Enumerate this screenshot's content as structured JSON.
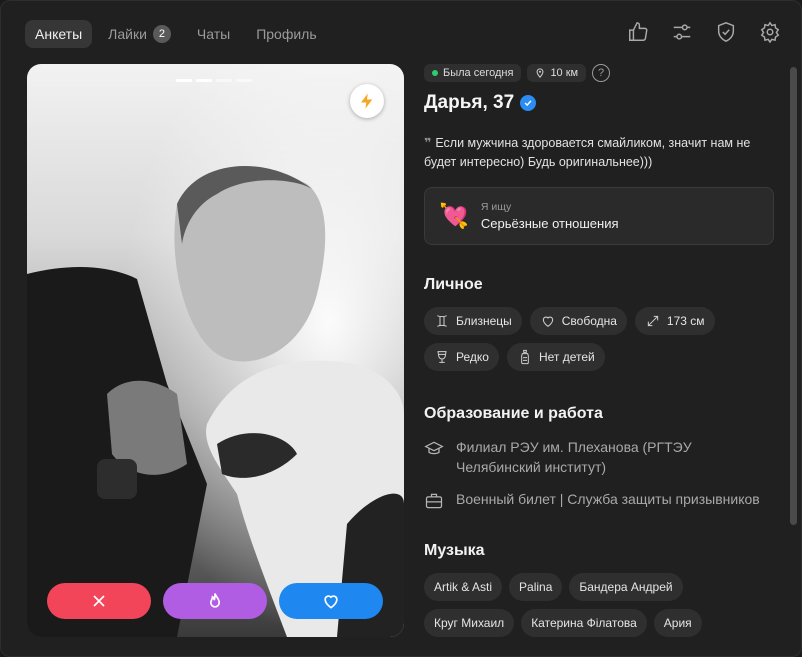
{
  "tabs": [
    {
      "label": "Анкеты",
      "active": true
    },
    {
      "label": "Лайки",
      "badge": "2"
    },
    {
      "label": "Чаты"
    },
    {
      "label": "Профиль"
    }
  ],
  "top_icons": [
    "thumbs-up-icon",
    "sliders-icon",
    "shield-check-icon",
    "gear-icon"
  ],
  "photo": {
    "pages_total": 4,
    "pages_active": 2
  },
  "status": {
    "online": "Была сегодня",
    "distance": "10 км",
    "help": "?"
  },
  "profile": {
    "name": "Дарья, 37"
  },
  "bio": "Если мужчина здоровается смайликом, значит нам не будет интересно) Будь оригинальнее)))",
  "seeking": {
    "label": "Я ищу",
    "value": "Серьёзные отношения"
  },
  "personal": {
    "title": "Личное",
    "chips": [
      {
        "label": "Близнецы",
        "icon": "gemini-icon"
      },
      {
        "label": "Свободна",
        "icon": "heart-outline-icon"
      },
      {
        "label": "173 см",
        "icon": "height-arrows-icon"
      },
      {
        "label": "Редко",
        "icon": "wine-glass-icon"
      },
      {
        "label": "Нет детей",
        "icon": "baby-bottle-icon"
      }
    ]
  },
  "education": {
    "title": "Образование и работа",
    "items": [
      {
        "text": "Филиал РЭУ им. Плеханова (РГТЭУ Челябинский институт)",
        "icon": "graduation-cap-icon"
      },
      {
        "text": "Военный билет | Служба защиты призывников",
        "icon": "briefcase-icon"
      }
    ]
  },
  "music": {
    "title": "Музыка",
    "chips": [
      "Artik & Asti",
      "Palina",
      "Бандера Андрей",
      "Круг Михаил",
      "Катерина Філатова",
      "Ария"
    ]
  },
  "colors": {
    "nope": "#f2455a",
    "super": "#b05ce3",
    "like": "#1e88f0",
    "online": "#2ecc71",
    "verified": "#2b8cf2"
  }
}
